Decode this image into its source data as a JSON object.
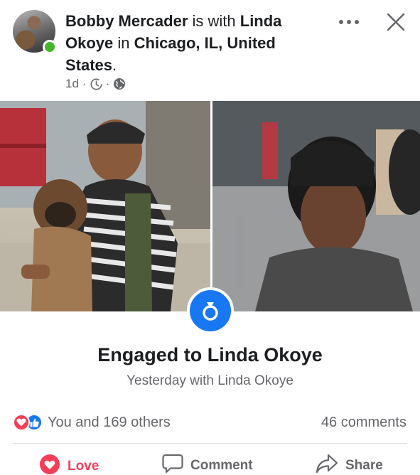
{
  "post": {
    "author": "Bobby Mercader",
    "with_word": " is with ",
    "tagged": "Linda Okoye",
    "in_word": " in ",
    "location": "Chicago, IL, United States",
    "period": ".",
    "time": "1d",
    "separator": "·",
    "visibility_icon": "globe-icon",
    "time_icon": "clock-icon"
  },
  "header_actions": {
    "more_icon": "more-dots-icon",
    "close_icon": "close-icon"
  },
  "life_event": {
    "icon": "ring-icon",
    "title": "Engaged to Linda Okoye",
    "subtitle": "Yesterday with Linda Okoye"
  },
  "engagement": {
    "reactions_text": "You and 169 others",
    "comments_text": "46 comments"
  },
  "actions": {
    "love_label": "Love",
    "comment_label": "Comment",
    "share_label": "Share"
  },
  "colors": {
    "brand_blue": "#1877f2",
    "love_red": "#f33e58",
    "online_green": "#42b72a",
    "secondary_text": "#65676b"
  }
}
